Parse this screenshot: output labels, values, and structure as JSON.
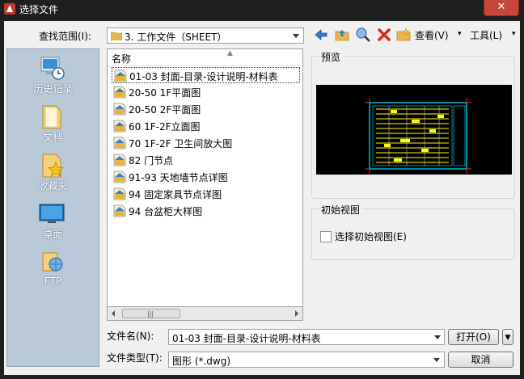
{
  "window": {
    "title": "选择文件",
    "close_label": "✕"
  },
  "lookin": {
    "label": "查找范围(I):",
    "value": "3. 工作文件（SHEET）"
  },
  "toolbar": {
    "view_label": "查看(V)",
    "tools_label": "工具(L)"
  },
  "places": [
    {
      "label": "历史记录",
      "icon": "history-icon"
    },
    {
      "label": "文档",
      "icon": "documents-folder-icon"
    },
    {
      "label": "收藏夹",
      "icon": "favorites-folder-icon"
    },
    {
      "label": "桌面",
      "icon": "desktop-icon"
    },
    {
      "label": "FTP",
      "icon": "ftp-icon"
    }
  ],
  "filelist": {
    "column_name": "名称",
    "files": [
      "01-03 封面-目录-设计说明-材料表",
      "20-50 1F平面图",
      "20-50 2F平面图",
      "60 1F-2F立面图",
      "70 1F-2F 卫生间放大图",
      "82 门节点",
      "91-93 天地墙节点详图",
      "94 固定家具节点详图",
      "94 台盆柜大样图"
    ],
    "selected_index": 0
  },
  "preview": {
    "title": "预览"
  },
  "initial_view": {
    "title": "初始视图",
    "checkbox_label": "选择初始视图(E)",
    "checked": false
  },
  "filename": {
    "label": "文件名(N):",
    "value": "01-03 封面-目录-设计说明-材料表"
  },
  "filetype": {
    "label": "文件类型(T):",
    "value": "图形 (*.dwg)"
  },
  "buttons": {
    "open": "打开(O)",
    "cancel": "取消"
  },
  "colors": {
    "places_bg": "#b9c9d8",
    "title_bg": "#1f1f1f",
    "close_bg": "#c7463a",
    "preview_bg": "#000000",
    "drawing_cyan": "#00ffff",
    "drawing_yellow": "#ffff00"
  }
}
